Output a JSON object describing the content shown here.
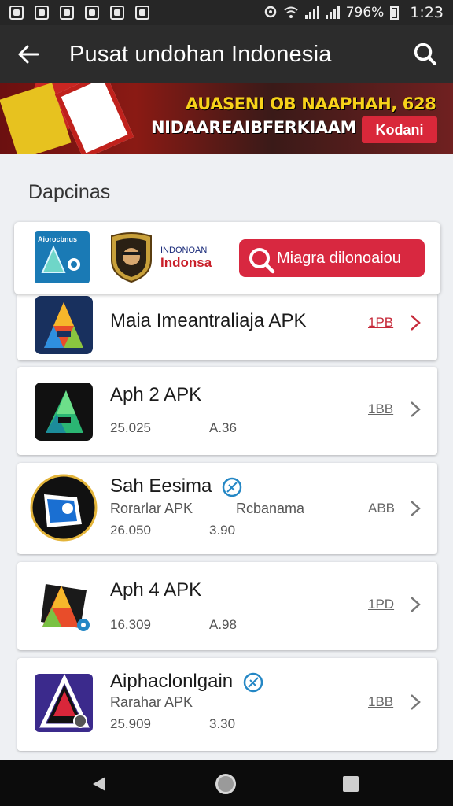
{
  "status_bar": {
    "battery_percent": "96%",
    "battery_prefix": "7",
    "time": "1:23"
  },
  "app_bar": {
    "title": "Pusat undohan Indonesia",
    "back_icon": "arrow-left-icon",
    "search_icon": "search-icon"
  },
  "banner": {
    "line1": "AUASENI OB NAAPHAH, 628",
    "line2": "NIDAAREAIBFERKIAAM",
    "button": "Kodani"
  },
  "section": {
    "title": "Dapcinas"
  },
  "featured": {
    "tile_label": "Aiorocbnus",
    "brand_line1": "INDONOAN",
    "brand_line2": "Indonsa",
    "search_button": "Miagra dilonoaiou"
  },
  "apps": [
    {
      "name": "Maia Imeantraliaja APK",
      "size": "1PB",
      "size_color": "#c62a3a"
    },
    {
      "name": "Aph 2 APK",
      "downloads": "25.025",
      "rating": "A.36",
      "size": "1BB"
    },
    {
      "name": "Sah Eesima",
      "verified": true,
      "developer": "Rorarlar APK",
      "category": "Rcbanama",
      "downloads": "26.050",
      "rating": "3.90",
      "size": "ABB"
    },
    {
      "name": "Aph 4 APK",
      "downloads": "16.309",
      "rating": "A.98",
      "size": "1PD"
    },
    {
      "name": "Aiphaclonlgain",
      "verified": true,
      "developer": "Rarahar APK",
      "downloads": "25.909",
      "rating": "3.30",
      "size": "1BB"
    }
  ],
  "nav": {
    "back": "triangle-back-icon",
    "home": "circle-home-icon",
    "recent": "square-recents-icon"
  }
}
